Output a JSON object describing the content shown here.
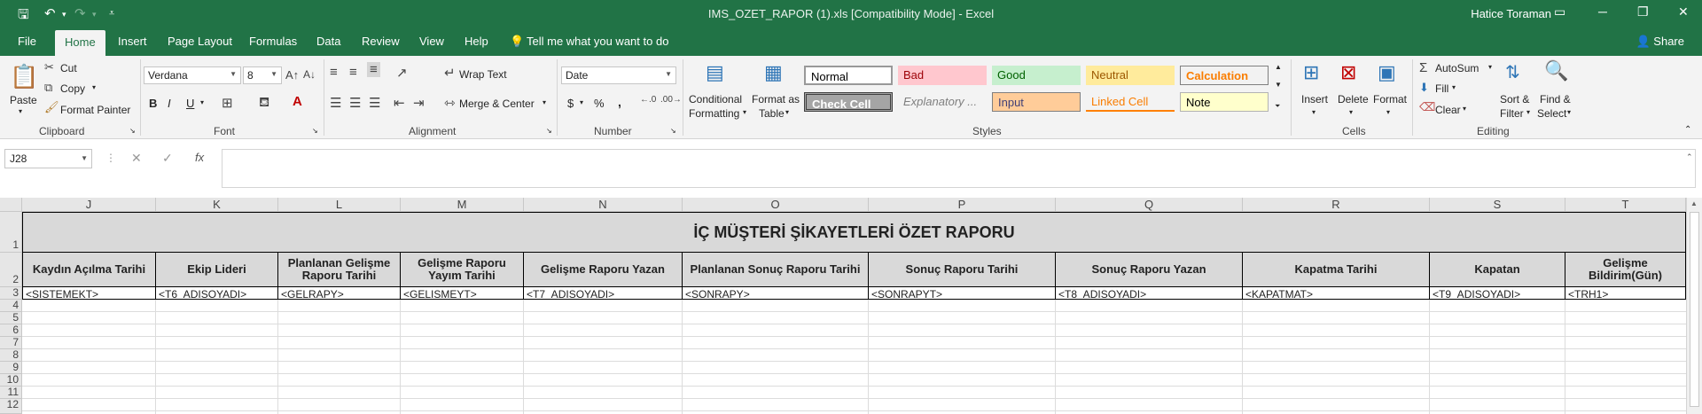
{
  "titlebar": {
    "window_title": "IMS_OZET_RAPOR (1).xls  [Compatibility Mode]  -  Excel",
    "user": "Hatice Toraman"
  },
  "tabs": [
    "File",
    "Home",
    "Insert",
    "Page Layout",
    "Formulas",
    "Data",
    "Review",
    "View",
    "Help"
  ],
  "active_tab": "Home",
  "tell_me": "Tell me what you want to do",
  "share": "Share",
  "ribbon": {
    "clipboard": {
      "paste": "Paste",
      "cut": "Cut",
      "copy": "Copy",
      "format_painter": "Format Painter",
      "group": "Clipboard"
    },
    "font": {
      "family": "Verdana",
      "size": "8",
      "bold": "B",
      "italic": "I",
      "underline": "U",
      "group": "Font"
    },
    "alignment": {
      "wrap_text": "Wrap Text",
      "merge_center": "Merge & Center",
      "group": "Alignment"
    },
    "number": {
      "format": "Date",
      "currency": "$",
      "percent": "%",
      "comma": ",",
      "group": "Number"
    },
    "cond_format": {
      "l1": "Conditional",
      "l2": "Formatting"
    },
    "format_table": {
      "l1": "Format as",
      "l2": "Table"
    },
    "styles": {
      "normal": "Normal",
      "bad": "Bad",
      "good": "Good",
      "neutral": "Neutral",
      "calculation": "Calculation",
      "check_cell": "Check Cell",
      "explanatory": "Explanatory ...",
      "input": "Input",
      "linked_cell": "Linked Cell",
      "note": "Note",
      "group": "Styles"
    },
    "cells": {
      "insert": "Insert",
      "delete": "Delete",
      "format": "Format",
      "group": "Cells"
    },
    "editing": {
      "autosum": "AutoSum",
      "fill": "Fill",
      "clear": "Clear",
      "sort_l1": "Sort &",
      "sort_l2": "Filter",
      "find_l1": "Find &",
      "find_l2": "Select",
      "group": "Editing"
    }
  },
  "formula_bar": {
    "name_box": "J28",
    "fx": "fx",
    "formula": ""
  },
  "columns": [
    "J",
    "K",
    "L",
    "M",
    "N",
    "O",
    "P",
    "Q",
    "R",
    "S",
    "T"
  ],
  "rows": [
    "1",
    "2",
    "3",
    "4",
    "5",
    "6",
    "7",
    "8",
    "9",
    "10",
    "11",
    "12"
  ],
  "sheet": {
    "title": "İÇ MÜŞTERİ ŞİKAYETLERİ ÖZET RAPORU",
    "headers": [
      "Kaydın Açılma Tarihi",
      "Ekip Lideri",
      "Planlanan Gelişme Raporu Tarihi",
      "Gelişme Raporu Yayım Tarihi",
      "Gelişme Raporu Yazan",
      "Planlanan Sonuç Raporu Tarihi",
      "Sonuç Raporu Tarihi",
      "Sonuç Raporu Yazan",
      "Kapatma Tarihi",
      "Kapatan",
      "Gelişme Bildirim(Gün)"
    ],
    "row3": [
      "<SISTEMEKT>",
      "<T6_ADISOYADI>",
      "<GELRAPY>",
      "<GELISMEYT>",
      "<T7_ADISOYADI>",
      "<SONRAPY>",
      "<SONRAPYT>",
      "<T8_ADISOYADI>",
      "<KAPATMAT>",
      "<T9_ADISOYADI>",
      "<TRH1>"
    ]
  },
  "colors": {
    "accent": "#217346",
    "header_fill": "#d9d9d9"
  }
}
